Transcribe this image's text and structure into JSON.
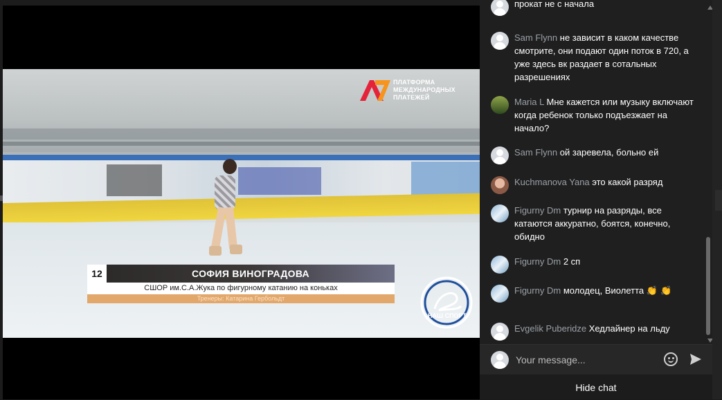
{
  "video": {
    "sponsor_text": "ПЛАТФОРМА МЕЖДУНАРОДНЫХ ПЛАТЕЖЕЙ",
    "channel_logo_text": "НАШ СПОРТ",
    "lower_third": {
      "number": "12",
      "name": "СОФИЯ ВИНОГРАДОВА",
      "club": "СШОР им.С.А.Жука по фигурному катанию на коньках",
      "coach": "Тренеры: Катарина Гербольдт"
    }
  },
  "chat": {
    "messages": [
      {
        "author": "",
        "text": "прокат не с начала",
        "avatar": "default"
      },
      {
        "author": "Sam Flynn",
        "text": "не зависит в каком качестве смотрите, они подают один поток в 720, а уже здесь вк раздает в сотальных разрешениях",
        "avatar": "default"
      },
      {
        "author": "Maria L",
        "text": "Мне кажется или музыку включают когда ребенок только подъезжает на начало?",
        "avatar": "maria"
      },
      {
        "author": "Sam Flynn",
        "text": "ой заревела, больно ей",
        "avatar": "default"
      },
      {
        "author": "Kuchmanova Yana",
        "text": "это какой разряд",
        "avatar": "yana"
      },
      {
        "author": "Figurny Dm",
        "text": "турнир на разряды, все катаются аккуратно, боятся, конечно, обидно",
        "avatar": "figurny"
      },
      {
        "author": "Figurny Dm",
        "text": "2 сп",
        "avatar": "figurny"
      },
      {
        "author": "Figurny Dm",
        "text": "молодец, Виолетта",
        "emoji": "👏 👏",
        "avatar": "figurny"
      },
      {
        "author": "Evgelik Puberidze",
        "text": "Хедлайнер на льду",
        "avatar": "default"
      }
    ],
    "input_placeholder": "Your message...",
    "hide_chat_label": "Hide chat"
  },
  "colors": {
    "chat_bg": "#1f1f1f",
    "author_gray": "#9aa0a6",
    "emoji_yellow": "#f4c542"
  },
  "icons": [
    "user-avatar-icon",
    "emoji-icon",
    "send-icon",
    "scroll-up-icon",
    "scroll-down-icon"
  ]
}
